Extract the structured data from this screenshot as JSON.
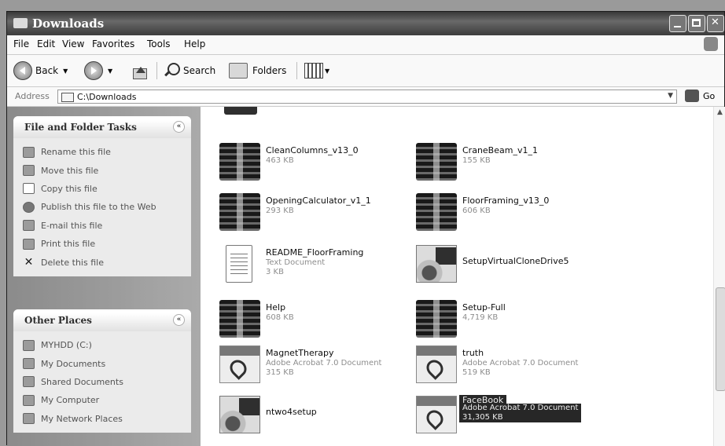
{
  "window": {
    "title": "Downloads"
  },
  "menu": [
    "File",
    "Edit",
    "View",
    "Favorites",
    "Tools",
    "Help"
  ],
  "toolbar": {
    "back": "Back",
    "search": "Search",
    "folders": "Folders"
  },
  "address": {
    "label": "Address",
    "value": "C:\\Downloads",
    "go": "Go"
  },
  "file_tasks": {
    "title": "File and Folder Tasks",
    "collapse_glyph": "«",
    "items": [
      {
        "label": "Rename this file",
        "icon": "rename-icon"
      },
      {
        "label": "Move this file",
        "icon": "move-icon"
      },
      {
        "label": "Copy this file",
        "icon": "copy-icon"
      },
      {
        "label": "Publish this file to the Web",
        "icon": "globe-icon"
      },
      {
        "label": "E-mail this file",
        "icon": "email-icon"
      },
      {
        "label": "Print this file",
        "icon": "print-icon"
      },
      {
        "label": "Delete this file",
        "icon": "delete-icon"
      }
    ]
  },
  "other_places": {
    "title": "Other Places",
    "collapse_glyph": "«",
    "items": [
      {
        "label": "MYHDD (C:)",
        "icon": "drive-icon"
      },
      {
        "label": "My Documents",
        "icon": "my-documents-icon"
      },
      {
        "label": "Shared Documents",
        "icon": "shared-documents-icon"
      },
      {
        "label": "My Computer",
        "icon": "my-computer-icon"
      },
      {
        "label": "My Network Places",
        "icon": "network-places-icon"
      }
    ]
  },
  "files": [
    {
      "name": "CleanColumns_v13_0",
      "meta1": "463 KB",
      "meta2": "",
      "icon": "rar-archive-icon"
    },
    {
      "name": "CraneBeam_v1_1",
      "meta1": "155 KB",
      "meta2": "",
      "icon": "rar-archive-icon"
    },
    {
      "name": "OpeningCalculator_v1_1",
      "meta1": "293 KB",
      "meta2": "",
      "icon": "rar-archive-icon"
    },
    {
      "name": "FloorFraming_v13_0",
      "meta1": "606 KB",
      "meta2": "",
      "icon": "rar-archive-icon"
    },
    {
      "name": "README_FloorFraming",
      "meta1": "Text Document",
      "meta2": "3 KB",
      "icon": "text-document-icon"
    },
    {
      "name": "SetupVirtualCloneDrive5",
      "meta1": "",
      "meta2": "",
      "icon": "installer-icon"
    },
    {
      "name": "Help",
      "meta1": "608 KB",
      "meta2": "",
      "icon": "rar-archive-icon"
    },
    {
      "name": "Setup-Full",
      "meta1": "4,719 KB",
      "meta2": "",
      "icon": "rar-archive-icon"
    },
    {
      "name": "MagnetTherapy",
      "meta1": "Adobe Acrobat 7.0 Document",
      "meta2": "315 KB",
      "icon": "pdf-icon"
    },
    {
      "name": "truth",
      "meta1": "Adobe Acrobat 7.0 Document",
      "meta2": "519 KB",
      "icon": "pdf-icon"
    },
    {
      "name": "ntwo4setup",
      "meta1": "",
      "meta2": "",
      "icon": "installer-icon"
    },
    {
      "name": "FaceBook",
      "meta1": "Adobe Acrobat 7.0 Document",
      "meta2": "31,305 KB",
      "icon": "pdf-icon",
      "selected": true
    }
  ]
}
